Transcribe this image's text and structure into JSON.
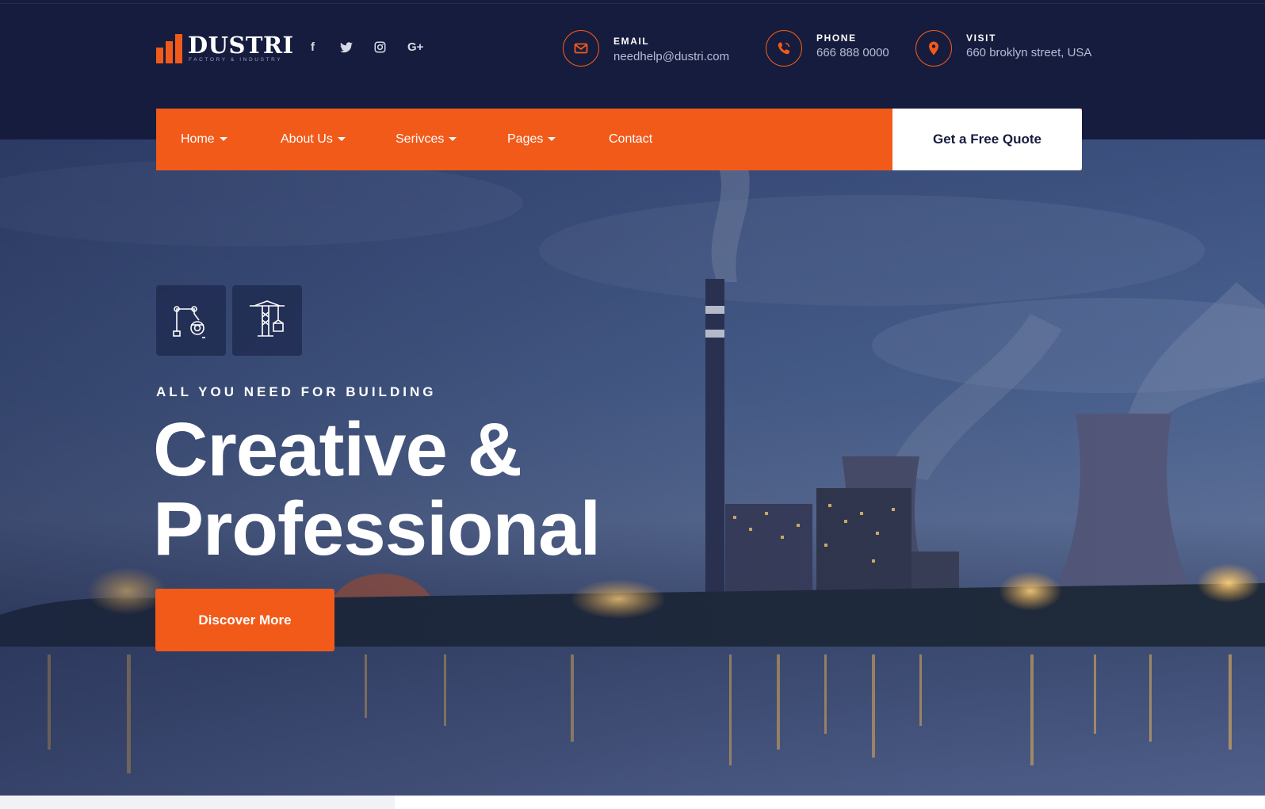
{
  "brand": {
    "name": "DUSTRI",
    "tagline": "FACTORY & INDUSTRY"
  },
  "socials": [
    {
      "icon": "facebook-icon",
      "glyph": "f"
    },
    {
      "icon": "twitter-icon",
      "glyph": "𝕥"
    },
    {
      "icon": "instagram-icon",
      "glyph": "◎"
    },
    {
      "icon": "google-plus-icon",
      "glyph": "G+"
    }
  ],
  "contacts": {
    "email": {
      "label": "EMAIL",
      "value": "needhelp@dustri.com",
      "icon": "envelope-icon"
    },
    "phone": {
      "label": "PHONE",
      "value": "666 888 0000",
      "icon": "phone-icon"
    },
    "visit": {
      "label": "VISIT",
      "value": "660 broklyn street, USA",
      "icon": "map-pin-icon"
    }
  },
  "nav": {
    "items": [
      {
        "label": "Home",
        "has_dropdown": true
      },
      {
        "label": "About Us",
        "has_dropdown": true
      },
      {
        "label": "Serivces",
        "has_dropdown": true
      },
      {
        "label": "Pages",
        "has_dropdown": true
      },
      {
        "label": "Contact",
        "has_dropdown": false
      }
    ],
    "cta_label": "Get a Free Quote"
  },
  "hero": {
    "feature_icons": [
      "robotic-arm-icon",
      "crane-icon"
    ],
    "kicker": "ALL YOU NEED FOR BUILDING",
    "headline_line1": "Creative &",
    "headline_line2": "Professional",
    "button_label": "Discover More"
  },
  "colors": {
    "accent": "#f25a1a",
    "dark_navy": "#161c3d",
    "text_muted": "#b6bbd6"
  }
}
